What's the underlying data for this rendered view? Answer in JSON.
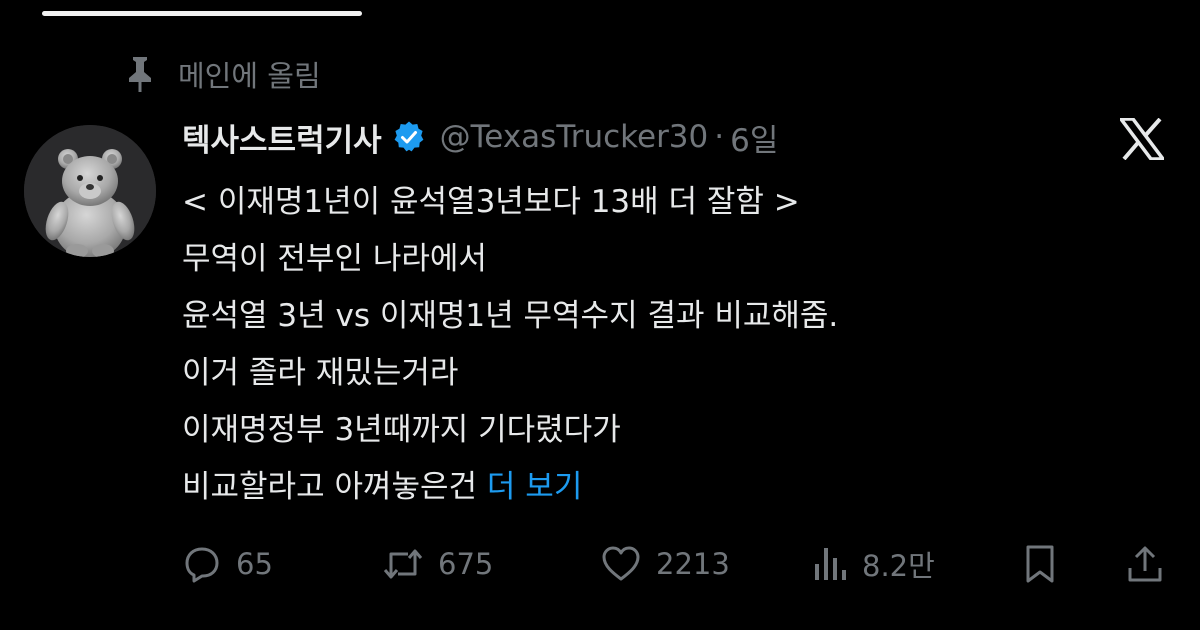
{
  "pinned": {
    "label": "메인에 올림"
  },
  "post": {
    "author": {
      "display_name": "텍사스트럭기사",
      "handle": "@TexasTrucker30",
      "verified": true
    },
    "separator": "·",
    "time": "6일",
    "lines": [
      "< 이재명1년이 윤석열3년보다 13배 더 잘함 >",
      "무역이 전부인 나라에서",
      "윤석열 3년 vs 이재명1년 무역수지 결과 비교해줌.",
      "이거 졸라 재밌는거라",
      "이재명정부 3년때까지 기다렸다가",
      "비교할라고 아껴놓은건 "
    ],
    "show_more": "더 보기"
  },
  "actions": {
    "replies": "65",
    "reposts": "675",
    "likes": "2213",
    "views": "8.2만"
  },
  "colors": {
    "background": "#000000",
    "text": "#e7e9ea",
    "muted": "#71767b",
    "link": "#1d9bf0",
    "verified_badge": "#1d9bf0"
  },
  "icons": [
    "pin-icon",
    "verified-badge-icon",
    "x-logo-icon",
    "reply-icon",
    "repost-icon",
    "like-icon",
    "views-icon",
    "bookmark-icon",
    "share-icon"
  ]
}
